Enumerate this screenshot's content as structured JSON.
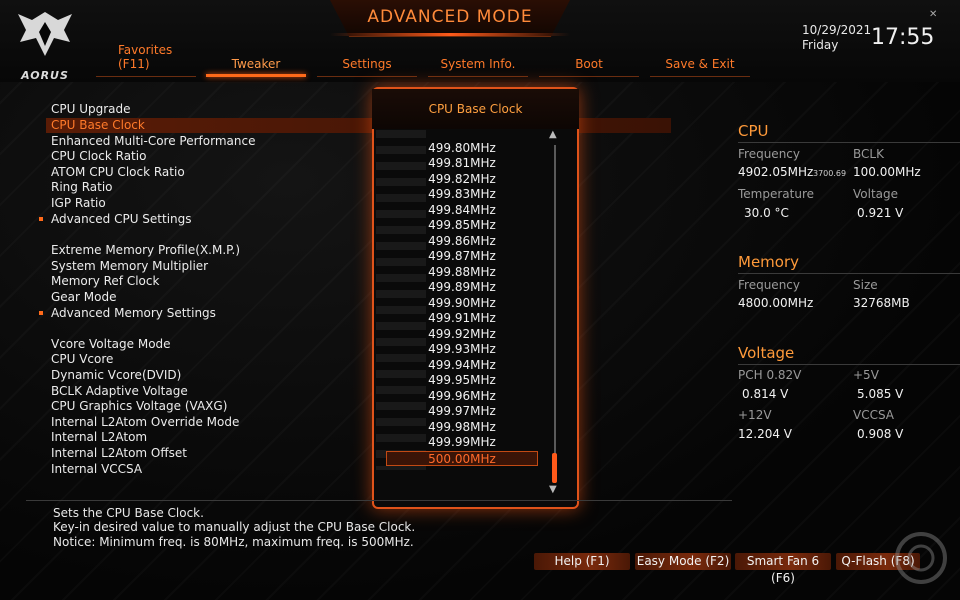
{
  "header": {
    "title": "ADVANCED MODE",
    "logo_text": "AORUS",
    "date": "10/29/2021",
    "day": "Friday",
    "time": "17:55"
  },
  "tabs": [
    {
      "label": "Favorites",
      "sub": "(F11)",
      "active": false
    },
    {
      "label": "Tweaker",
      "active": true
    },
    {
      "label": "Settings",
      "active": false
    },
    {
      "label": "System Info.",
      "active": false
    },
    {
      "label": "Boot",
      "active": false
    },
    {
      "label": "Save & Exit",
      "active": false
    }
  ],
  "menu": {
    "items": [
      "CPU Upgrade",
      "CPU Base Clock",
      "Enhanced Multi-Core Performance",
      "CPU Clock Ratio",
      "ATOM CPU Clock Ratio",
      "Ring Ratio",
      "IGP Ratio",
      "Advanced CPU Settings",
      "Extreme Memory Profile(X.M.P.)",
      "System Memory Multiplier",
      "Memory Ref Clock",
      "Gear Mode",
      "Advanced Memory Settings",
      "Vcore Voltage Mode",
      "CPU Vcore",
      "Dynamic Vcore(DVID)",
      "BCLK Adaptive Voltage",
      "CPU Graphics Voltage (VAXG)",
      "Internal L2Atom Override Mode",
      "Internal L2Atom",
      "Internal L2Atom Offset",
      "Internal VCCSA"
    ],
    "selected": "CPU Base Clock"
  },
  "popup": {
    "title": "CPU Base Clock",
    "options": [
      "499.80MHz",
      "499.81MHz",
      "499.82MHz",
      "499.83MHz",
      "499.84MHz",
      "499.85MHz",
      "499.86MHz",
      "499.87MHz",
      "499.88MHz",
      "499.89MHz",
      "499.90MHz",
      "499.91MHz",
      "499.92MHz",
      "499.93MHz",
      "499.94MHz",
      "499.95MHz",
      "499.96MHz",
      "499.97MHz",
      "499.98MHz",
      "499.99MHz",
      "500.00MHz"
    ],
    "selected": "500.00MHz",
    "scroll_fraction": 1.0
  },
  "cpu": {
    "title": "CPU",
    "frequency_label": "Frequency",
    "frequency_value": "4902.05MHz",
    "frequency_sub": "3700.69",
    "bclk_label": "BCLK",
    "bclk_value": "100.00MHz",
    "temperature_label": "Temperature",
    "temperature_value": "30.0 °C",
    "voltage_label": "Voltage",
    "voltage_value": "0.921 V"
  },
  "memory": {
    "title": "Memory",
    "frequency_label": "Frequency",
    "frequency_value": "4800.00MHz",
    "size_label": "Size",
    "size_value": "32768MB"
  },
  "voltage": {
    "title": "Voltage",
    "pch_label": "PCH 0.82V",
    "pch_value": "0.814 V",
    "v5_label": "+5V",
    "v5_value": "5.085 V",
    "v12_label": "+12V",
    "v12_value": "12.204 V",
    "vccsa_label": "VCCSA",
    "vccsa_value": "0.908 V"
  },
  "help": {
    "line1": "Sets the CPU Base Clock.",
    "line2": "Key-in desired value to manually adjust the CPU Base Clock.",
    "line3": "Notice: Minimum freq. is 80MHz, maximum freq. is 500MHz."
  },
  "buttons": {
    "help": "Help (F1)",
    "easy_mode": "Easy Mode (F2)",
    "smart_fan": "Smart Fan 6 (F6)",
    "qflash": "Q-Flash (F8)"
  },
  "colors": {
    "accent": "#ff6a1a",
    "accent_text": "#ff7a2a",
    "section_title": "#ff9a3a",
    "background": "#070707"
  }
}
